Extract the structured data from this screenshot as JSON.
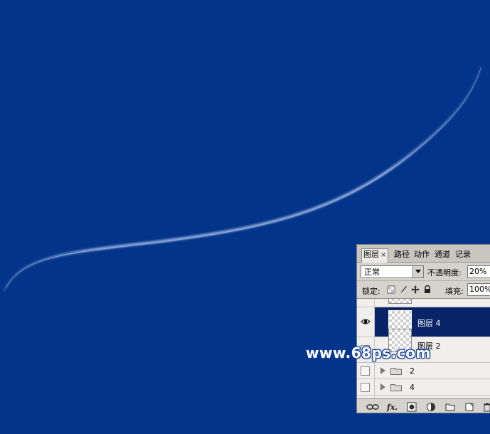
{
  "layers_panel": {
    "tabs": [
      {
        "label": "图层",
        "active": true,
        "close": "×"
      },
      {
        "label": "路径"
      },
      {
        "label": "动作"
      },
      {
        "label": "通道"
      },
      {
        "label": "记录"
      }
    ],
    "blend_mode": "正常",
    "opacity_label": "不透明度:",
    "opacity_value": "20%",
    "lock_label": "锁定:",
    "fill_label": "填充:",
    "fill_value": "100%",
    "layers": [
      {
        "name": "",
        "partial": true
      },
      {
        "name": "图层 4",
        "selected": true,
        "visible": true
      },
      {
        "name": "图层 2"
      },
      {
        "name": "2",
        "group": true
      },
      {
        "name": "4",
        "group": true
      }
    ]
  },
  "watermark": "www.68ps.com",
  "colors": {
    "canvas_bg": "#02358a",
    "selected_row": "#0a2468",
    "panel_bg": "#d6d3ce"
  }
}
